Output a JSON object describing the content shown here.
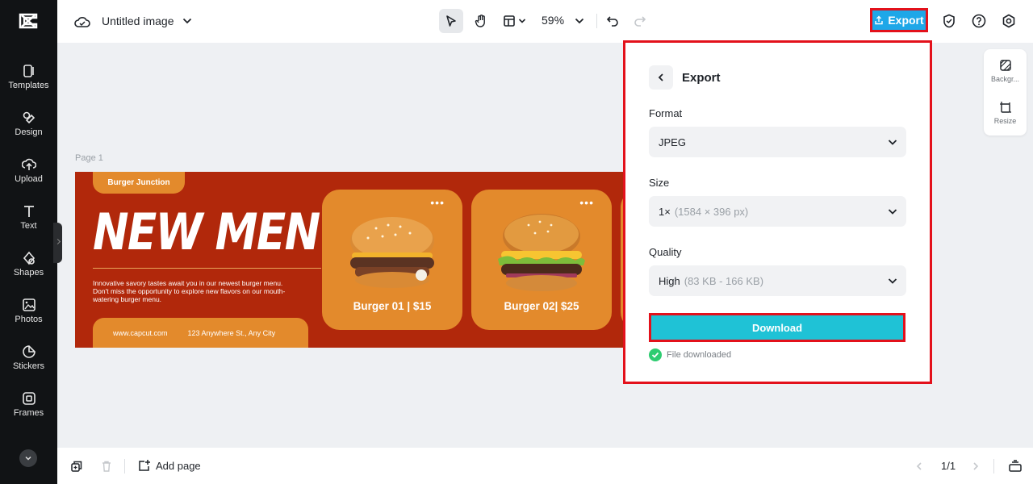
{
  "sidebar": {
    "items": [
      {
        "label": "Templates",
        "icon": "templates-icon"
      },
      {
        "label": "Design",
        "icon": "design-icon"
      },
      {
        "label": "Upload",
        "icon": "upload-icon"
      },
      {
        "label": "Text",
        "icon": "text-icon"
      },
      {
        "label": "Shapes",
        "icon": "shapes-icon"
      },
      {
        "label": "Photos",
        "icon": "photos-icon"
      },
      {
        "label": "Stickers",
        "icon": "stickers-icon"
      },
      {
        "label": "Frames",
        "icon": "frames-icon"
      }
    ]
  },
  "header": {
    "title": "Untitled image",
    "zoom": "59%",
    "export_label": "Export"
  },
  "canvas": {
    "page_label": "Page 1",
    "banner": {
      "brand": "Burger Junction",
      "headline": "NEW MENU",
      "tagline": "Innovative savory tastes await you in our newest burger menu. Don't miss the opportunity to explore new flavors on our mouth-watering burger menu.",
      "website": "www.capcut.com",
      "address": "123 Anywhere St., Any City",
      "cards": [
        {
          "name": "Burger 01 | $15",
          "menu": "•••"
        },
        {
          "name": "Burger 02| $25",
          "menu": "•••"
        }
      ]
    }
  },
  "right_tools": {
    "items": [
      {
        "label": "Backgr..."
      },
      {
        "label": "Resize"
      }
    ]
  },
  "export_panel": {
    "title": "Export",
    "format": {
      "label": "Format",
      "value": "JPEG"
    },
    "size": {
      "label": "Size",
      "value": "1×",
      "detail": "(1584 × 396 px)"
    },
    "quality": {
      "label": "Quality",
      "value": "High",
      "detail": "(83 KB - 166 KB)"
    },
    "download_label": "Download",
    "status": "File downloaded"
  },
  "footer": {
    "add_page_label": "Add page",
    "pager": "1/1"
  },
  "colors": {
    "accent": "#1ea7e8",
    "download": "#1fc2d6",
    "banner": "#b1280b",
    "card": "#e38a2c",
    "highlight": "#e3111b",
    "success": "#2ecc71"
  }
}
